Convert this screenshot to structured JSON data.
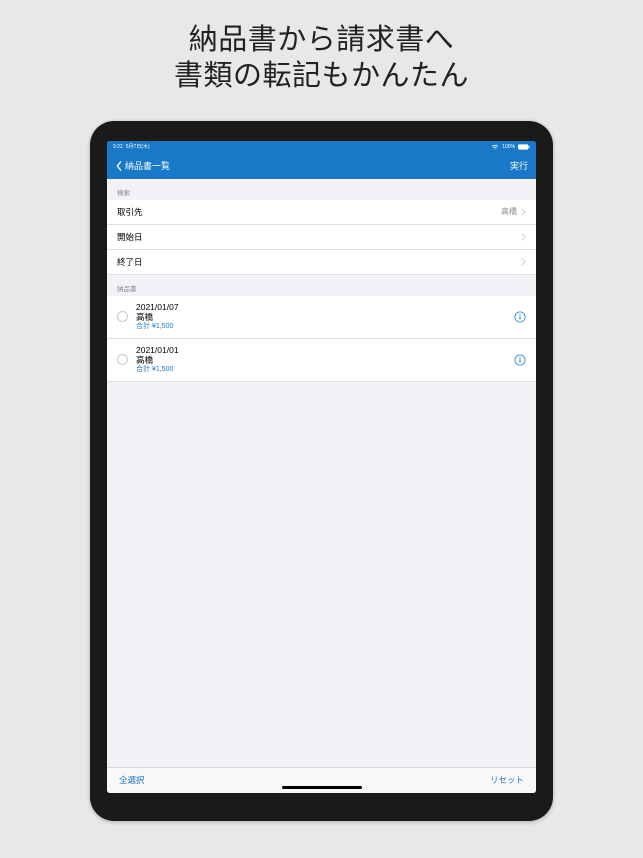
{
  "headline": {
    "line1": "納品書から請求書へ",
    "line2": "書類の転記もかんたん"
  },
  "statusbar": {
    "time": "9:22",
    "date": "5月7日(木)",
    "charge": "100%"
  },
  "nav": {
    "back": "納品書一覧",
    "action": "実行"
  },
  "filter": {
    "header": "検索",
    "client_label": "取引先",
    "client_value": "高橋",
    "start_label": "開始日",
    "end_label": "終了日"
  },
  "list": {
    "header": "納品書",
    "items": [
      {
        "date": "2021/01/07",
        "client": "高橋",
        "total": "合計 ¥1,500"
      },
      {
        "date": "2021/01/01",
        "client": "高橋",
        "total": "合計 ¥1,500"
      }
    ]
  },
  "toolbar": {
    "selectAll": "全選択",
    "reset": "リセット"
  }
}
